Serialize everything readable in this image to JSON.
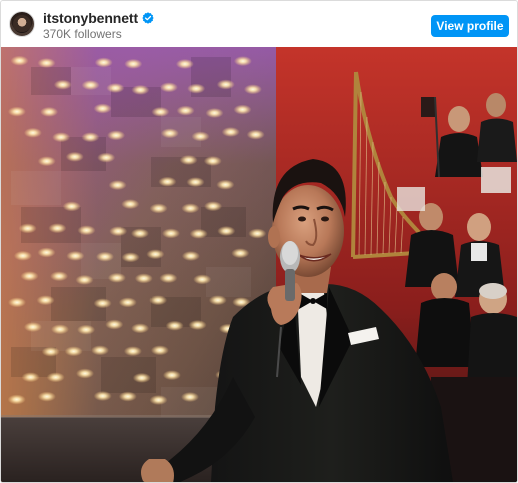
{
  "post": {
    "username": "itstonybennett",
    "followers": "370K followers",
    "view_profile_label": "View profile",
    "verified": true
  },
  "colors": {
    "accent": "#0095f6",
    "verified": "#0095f6",
    "username": "#262626",
    "secondary_text": "#737373"
  },
  "icons": {
    "verified": "verified-badge-icon"
  }
}
